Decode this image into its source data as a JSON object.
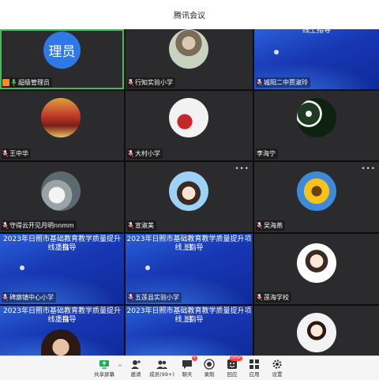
{
  "window": {
    "title": "腾讯会议"
  },
  "tiles": [
    {
      "name": "超级管理员",
      "avatar_text": "理员",
      "active": true
    },
    {
      "name": "行知实验小学",
      "avatar": "person-with-bike"
    },
    {
      "name": "城阳二中贾淑玲",
      "slide_title": "线上指导"
    },
    {
      "name": "王中华",
      "avatar": "forbidden-city"
    },
    {
      "name": "大村小学",
      "avatar": "girl-with-bouquet"
    },
    {
      "name": "李海宁",
      "avatar": "flowers-dark"
    },
    {
      "name": "守得云开见月明nnmm",
      "avatar": "swans"
    },
    {
      "name": "宣淑美",
      "avatar": "cartoon-girl"
    },
    {
      "name": "吴海燕",
      "avatar": "sunflower"
    },
    {
      "name": "碑廓镇中心小学",
      "slide_title": "2023年日照市基础教育教学质量提升项目线上指导"
    },
    {
      "name": "五莲县实验小学",
      "slide_title": "2023年日照市基础教育教学质量提升项目线上指导"
    },
    {
      "name": "莲海学校",
      "avatar": "cartoon-girl-2"
    },
    {
      "name": "",
      "slide_title": "2023年日照市基础教育教学质量提升项目线上指导"
    },
    {
      "name": "",
      "slide_title": "2023年日照市基础教育教学质量提升项目线上指导"
    },
    {
      "name": "",
      "avatar": "cartoon-family"
    }
  ],
  "slide_lines": [
    "2023年日照市基础教育教学质量提升项目",
    "线上指导"
  ],
  "toolbar": {
    "share": "共享屏幕",
    "invite": "邀请",
    "members": "成员(99+)",
    "chat": "聊天",
    "chat_badge": "8",
    "record": "录制",
    "replay": "回应",
    "replay_badge": "NEW",
    "apps": "应用",
    "settings": "设置"
  },
  "colors": {
    "active_border": "#3fbf5a",
    "slide_blue": "#1737b3",
    "tile_bg": "#2b2b2d"
  }
}
